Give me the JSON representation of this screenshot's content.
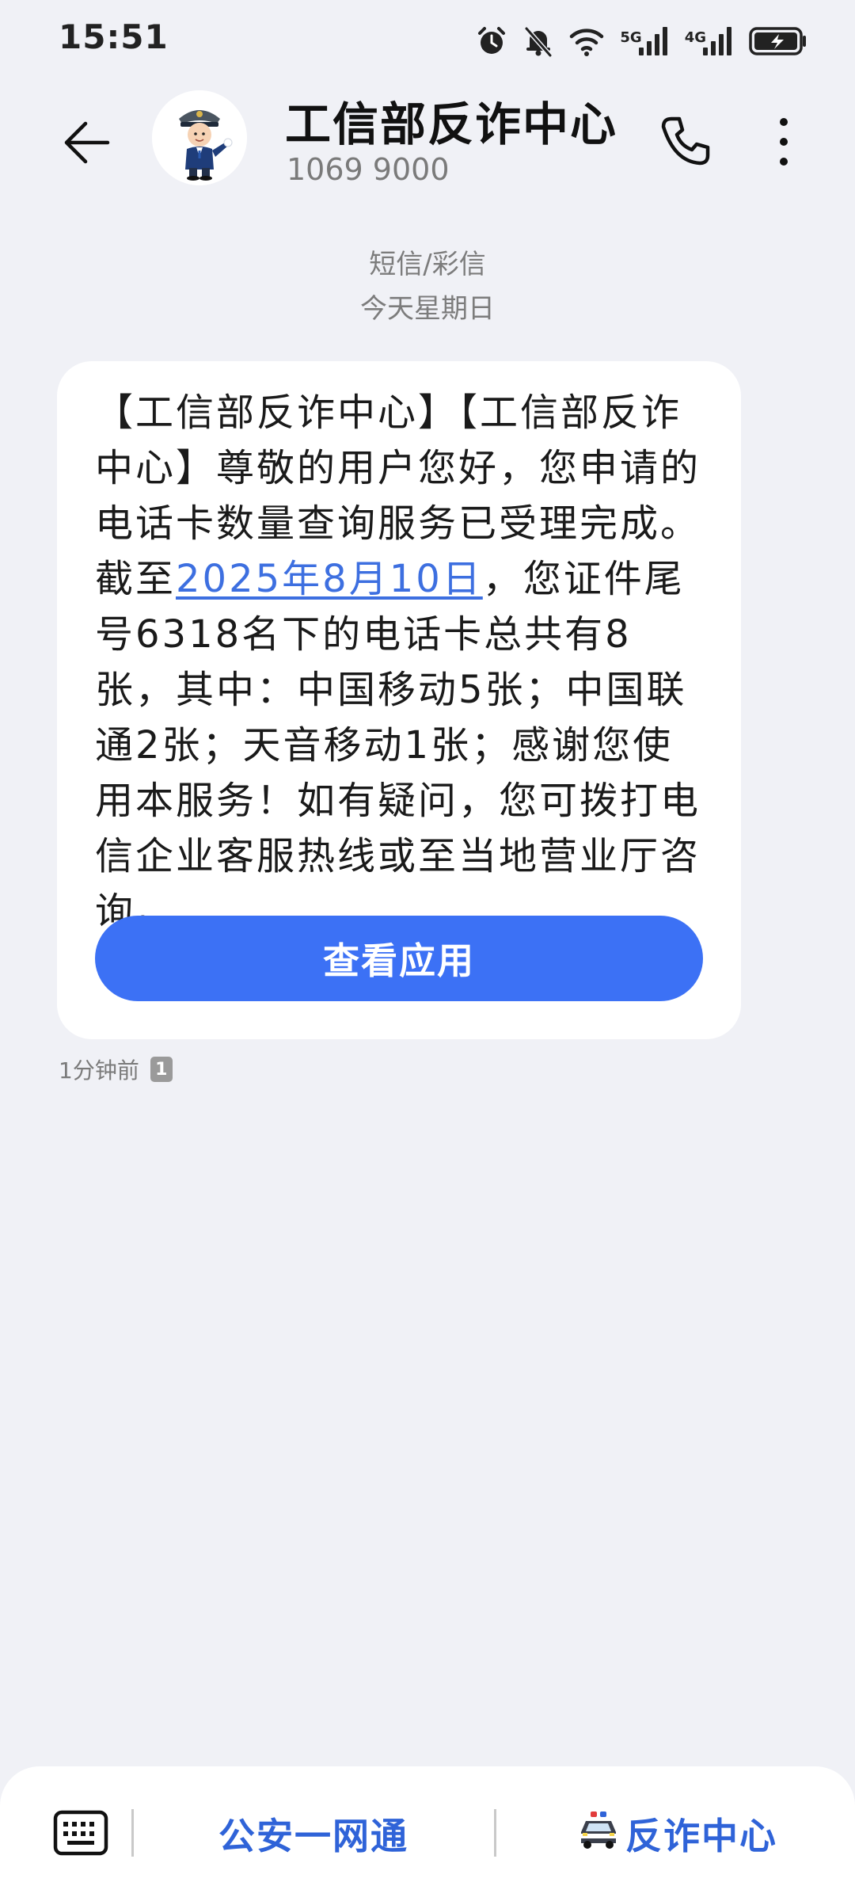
{
  "status_bar": {
    "time": "15:51",
    "net_5g": "5G",
    "net_4g": "4G",
    "icons": [
      "alarm-icon",
      "mute-bell-icon",
      "wifi-icon",
      "signal-5g-icon",
      "signal-4g-icon",
      "battery-charging-icon"
    ]
  },
  "header": {
    "name": "工信部反诈中心",
    "number": "1069 9000",
    "icons": [
      "back-arrow-icon",
      "police-avatar",
      "phone-icon",
      "more-vertical-icon"
    ]
  },
  "separator": {
    "type": "短信/彩信",
    "date": "今天星期日"
  },
  "message": {
    "text_before_link": "【工信部反诈中心】【工信部反诈中心】尊敬的用户您好，您申请的电话卡数量查询服务已受理完成。截至",
    "link": "2025年8月10日",
    "text_after_link": "，您证件尾号6318名下的电话卡总共有8张，其中：中国移动5张；中国联通2张；天音移动1张；感谢您使用本服务！如有疑问，您可拨打电信企业客服热线或至当地营业厅咨询。",
    "button": "查看应用",
    "time": "1分钟前",
    "sim": "1"
  },
  "bottom_bar": {
    "menu_1": "公安一网通",
    "menu_2": "反诈中心",
    "icons": [
      "keyboard-icon",
      "police-car-icon"
    ]
  },
  "colors": {
    "background": "#f0f1f6",
    "accent": "#3c71f5",
    "link": "#3d6fe0",
    "menu_text": "#2f63d8"
  }
}
